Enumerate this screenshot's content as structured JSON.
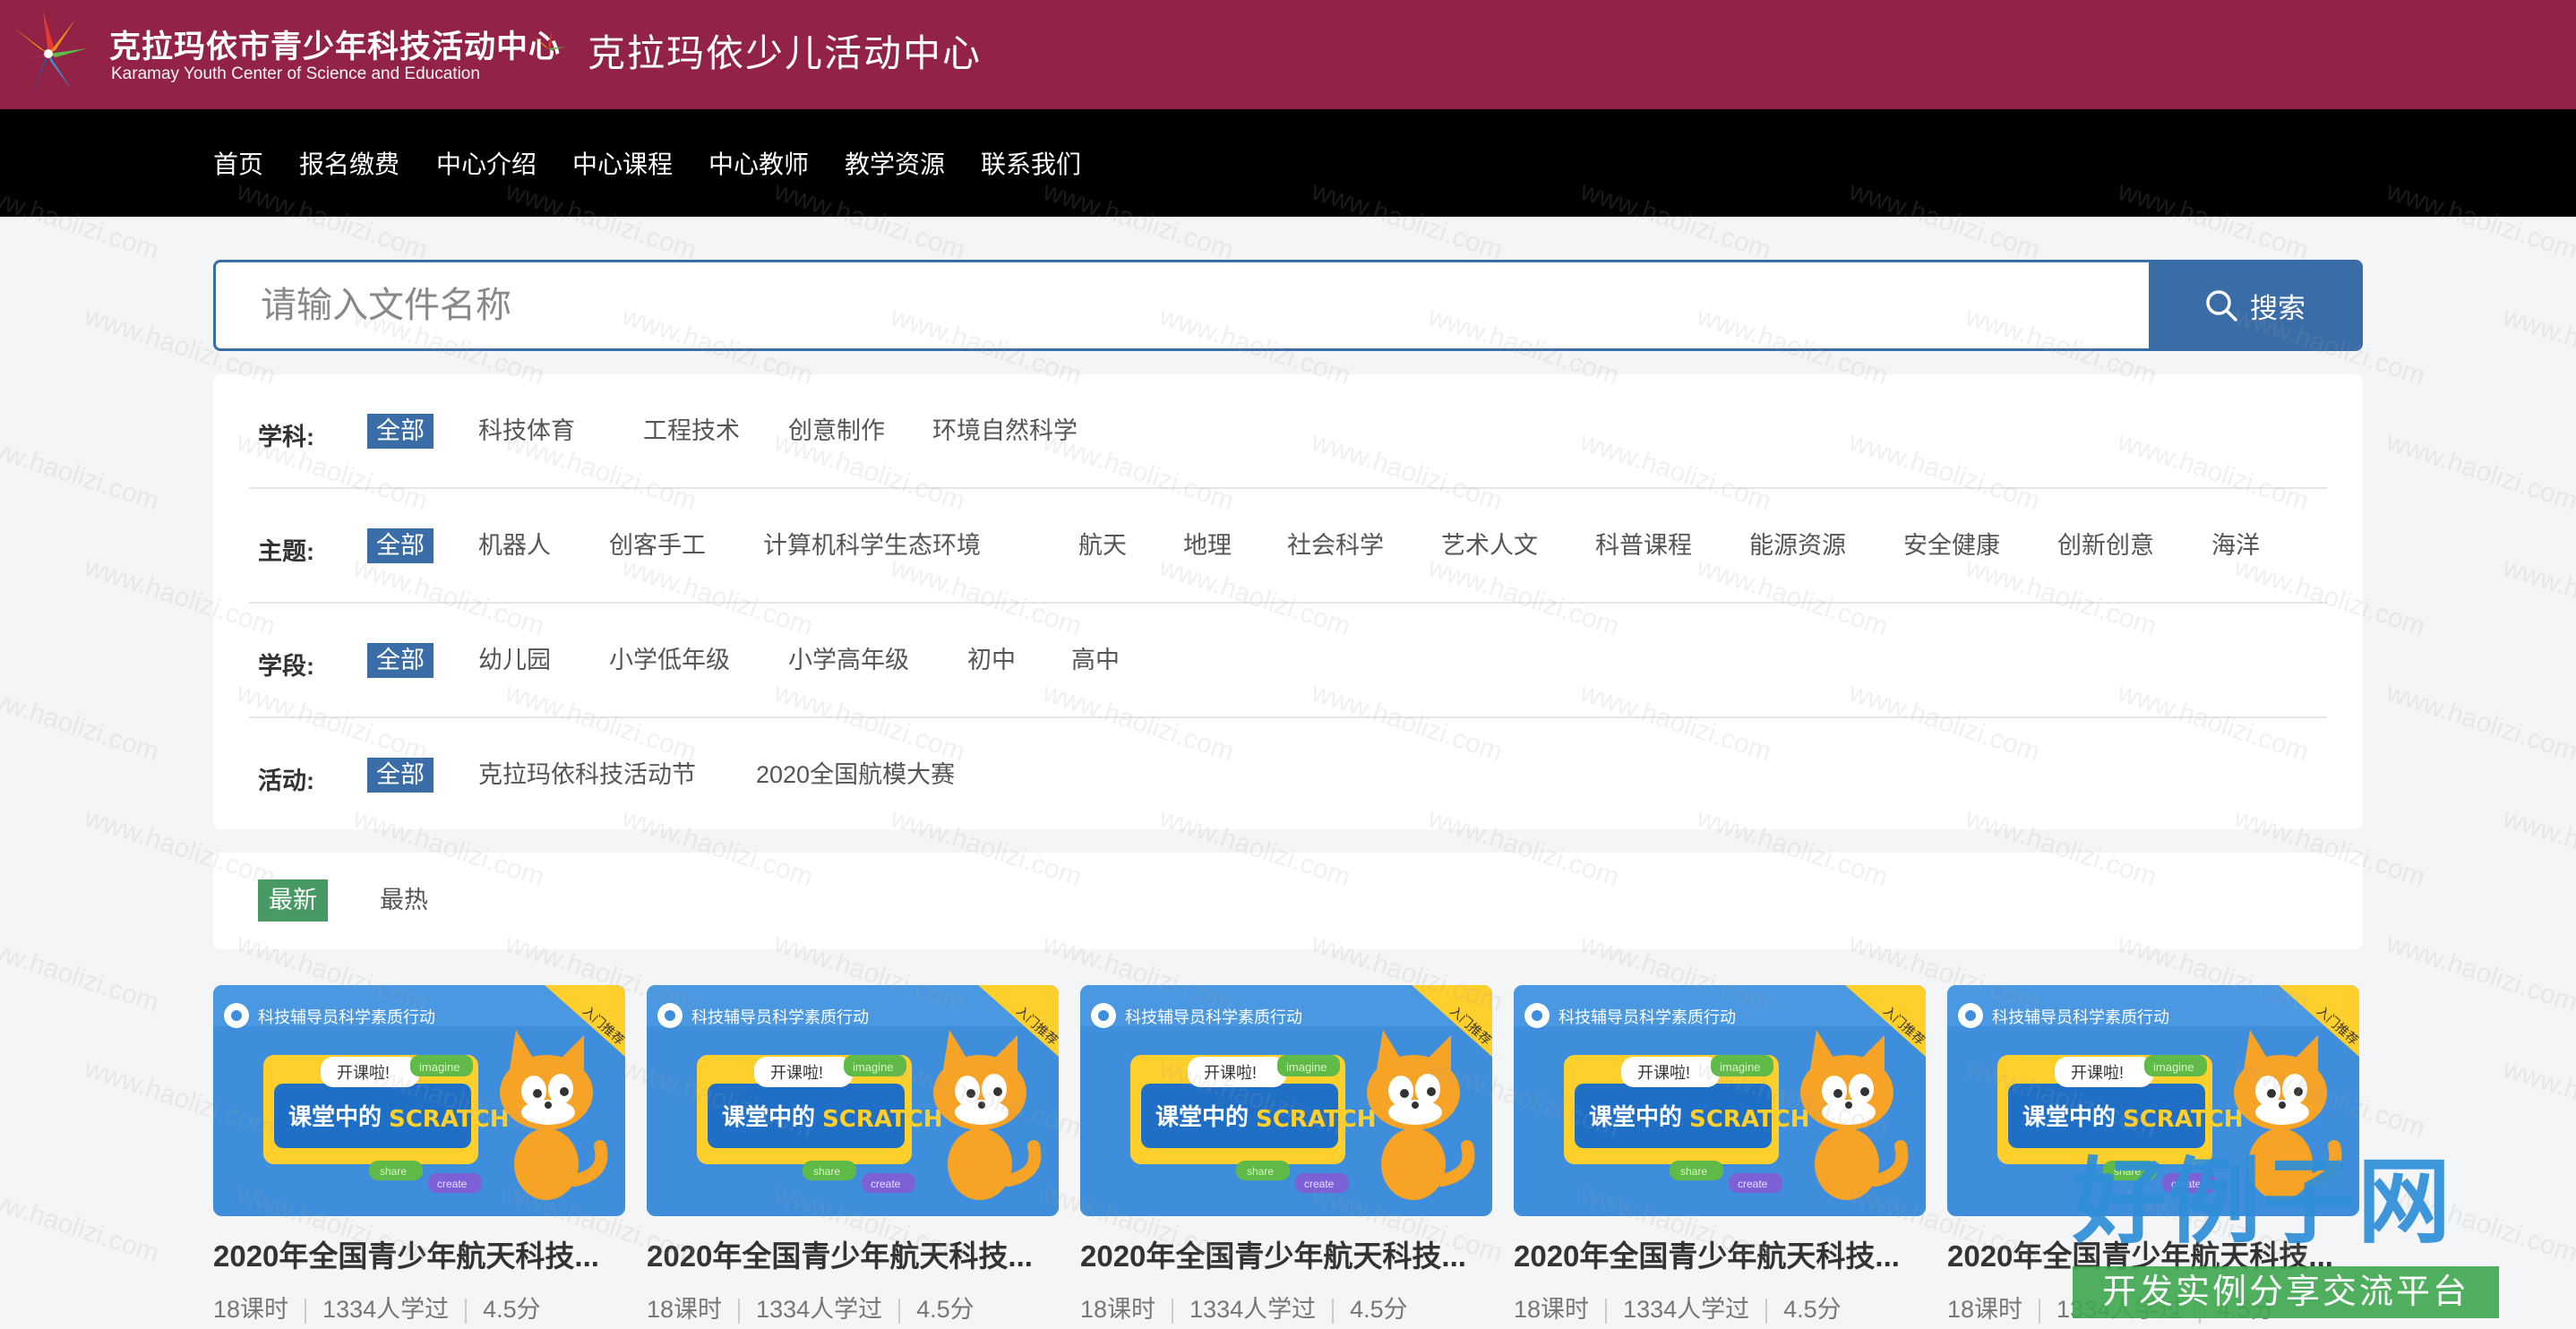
{
  "header": {
    "brand_cn": "克拉玛依市青少年科技活动中心",
    "brand_en": "Karamay Youth Center of Science and Education",
    "brand2": "克拉玛依少儿活动中心",
    "bg_color": "#922346"
  },
  "nav": {
    "items": [
      {
        "label": "首页"
      },
      {
        "label": "报名缴费"
      },
      {
        "label": "中心介绍"
      },
      {
        "label": "中心课程"
      },
      {
        "label": "中心教师"
      },
      {
        "label": "教学资源"
      },
      {
        "label": "联系我们"
      }
    ]
  },
  "search": {
    "placeholder": "请输入文件名称",
    "value": "",
    "button_label": "搜索",
    "icon": "search-icon"
  },
  "filters": [
    {
      "label": "学科:",
      "options": [
        "全部",
        "科技体育",
        "工程技术",
        "创意制作",
        "环境自然科学"
      ],
      "selected": "全部"
    },
    {
      "label": "主题:",
      "options": [
        "全部",
        "机器人",
        "创客手工",
        "计算机科学生态环境",
        "航天",
        "地理",
        "社会科学",
        "艺术人文",
        "科普课程",
        "能源资源",
        "安全健康",
        "创新创意",
        "海洋"
      ],
      "selected": "全部"
    },
    {
      "label": "学段:",
      "options": [
        "全部",
        "幼儿园",
        "小学低年级",
        "小学高年级",
        "初中",
        "高中"
      ],
      "selected": "全部"
    },
    {
      "label": "活动:",
      "options": [
        "全部",
        "克拉玛依科技活动节",
        "2020全国航模大赛"
      ],
      "selected": "全部"
    }
  ],
  "sort": {
    "options": [
      "最新",
      "最热"
    ],
    "selected": "最新"
  },
  "card_thumb": {
    "header_text": "科技辅导员科学素质行动",
    "ribbon": "入门推荐",
    "badge": "开课啦!",
    "title_cn": "课堂中的",
    "title_en": "SCRATCH",
    "tag1": "imagine",
    "tag2": "share",
    "tag3": "create"
  },
  "courses": [
    {
      "title": "2020年全国青少年航天科技...",
      "lessons": "18课时",
      "learners": "1334人学过",
      "rating": "4.5分"
    },
    {
      "title": "2020年全国青少年航天科技...",
      "lessons": "18课时",
      "learners": "1334人学过",
      "rating": "4.5分"
    },
    {
      "title": "2020年全国青少年航天科技...",
      "lessons": "18课时",
      "learners": "1334人学过",
      "rating": "4.5分"
    },
    {
      "title": "2020年全国青少年航天科技...",
      "lessons": "18课时",
      "learners": "1334人学过",
      "rating": "4.5分"
    },
    {
      "title": "2020年全国青少年航天科技...",
      "lessons": "18课时",
      "learners": "1334人学过",
      "rating": "4.5分"
    }
  ],
  "watermark": {
    "text": "www.haolizi.com",
    "corner_big": "好例子网",
    "corner_sub": "开发实例分享交流平台"
  },
  "colors": {
    "accent": "#3a6ca8",
    "sort_active": "#479a63",
    "nav_bg": "#000000"
  }
}
